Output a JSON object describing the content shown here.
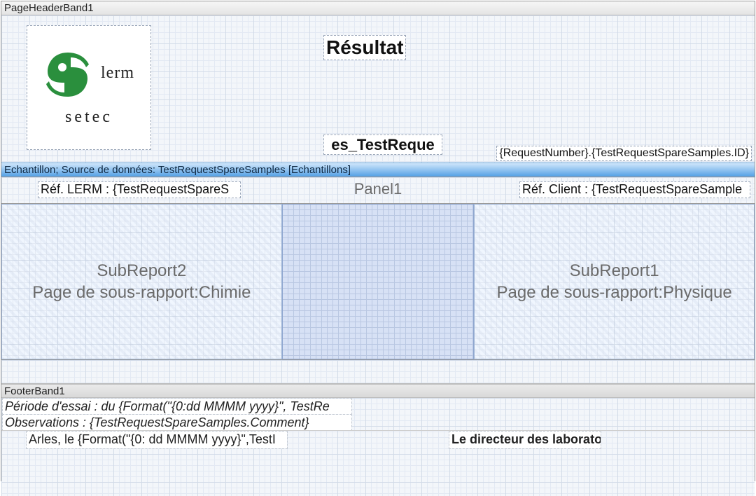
{
  "bands": {
    "pageHeader": "PageHeaderBand1",
    "dataHeader": "Echantillon; Source de données: TestRequestSpareSamples [Echantillons]",
    "footer": "FooterBand1"
  },
  "header": {
    "logo_lerm": "lerm",
    "logo_setec": "setec",
    "title": "Résultat",
    "midField": "es_TestReque",
    "idField": "{RequestNumber}.{TestRequestSpareSamples.ID}"
  },
  "dataRow": {
    "refLerm": "Réf. LERM : {TestRequestSpareS",
    "panelName": "Panel1",
    "refClient": "Réf. Client : {TestRequestSpareSample"
  },
  "subreports": {
    "left_name": "SubReport2",
    "left_page": "Page de sous-rapport:Chimie",
    "right_name": "SubReport1",
    "right_page": "Page de sous-rapport:Physique"
  },
  "footerFields": {
    "period": "Période d'essai : du {Format(\"{0:dd MMMM yyyy}\",  TestRe",
    "observations": "Observations : {TestRequestSpareSamples.Comment}",
    "arles": "Arles, le {Format(\"{0: dd MMMM yyyy}\",TestI",
    "director": "Le directeur des laboratoi"
  }
}
